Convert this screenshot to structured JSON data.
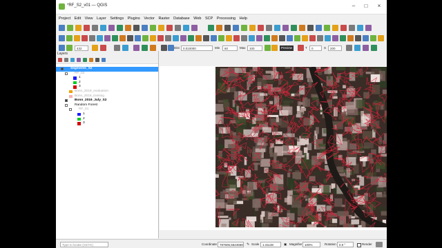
{
  "window": {
    "title": "*RF_S2_v01 — QGIS"
  },
  "menu": [
    "Project",
    "Edit",
    "View",
    "Layer",
    "Settings",
    "Plugins",
    "Vector",
    "Raster",
    "Database",
    "Web",
    "SCP",
    "Processing",
    "Help"
  ],
  "scp_toolbar": {
    "rgb_value": "432",
    "dist_label": "Dist",
    "dist_value": "0.010000",
    "min_label": "Min",
    "min_value": "60",
    "max_label": "Max",
    "max_value": "100",
    "preview_label": "Preview",
    "t_label": "T",
    "t_value": "0",
    "s_label": "S",
    "s_value": "200"
  },
  "layers_panel": {
    "title": "Layers",
    "layers": [
      {
        "label": "Segments_S2",
        "bold": true,
        "selected": true,
        "checked": true,
        "indent": 0
      },
      {
        "label": "RF_02",
        "muted": true,
        "checked": false,
        "indent": 1,
        "has_icon": true
      },
      {
        "label": "1",
        "swatch": "#1a1aff",
        "indent": 2
      },
      {
        "label": "2",
        "swatch": "#00cc22",
        "indent": 2
      },
      {
        "label": "3",
        "swatch": "#d40000",
        "indent": 2
      },
      {
        "label": "Bonn_2019_evaluation",
        "muted": true,
        "swatch": "#f0a000",
        "indent": 1
      },
      {
        "label": "Bonn_2019_training",
        "muted": true,
        "swatch": "#f8b0b0",
        "indent": 1
      },
      {
        "label": "Bonn_2019_July_S2",
        "bold": true,
        "checked": true,
        "indent": 1,
        "has_icon": true
      },
      {
        "label": "Random Forest",
        "checked": false,
        "indent": 1,
        "group": true
      },
      {
        "label": "RF_01",
        "muted": true,
        "checked": false,
        "indent": 2,
        "has_icon": true
      },
      {
        "label": "1",
        "swatch": "#1a1aff",
        "indent": 3
      },
      {
        "label": "2",
        "swatch": "#00cc22",
        "indent": 3
      },
      {
        "label": "3",
        "swatch": "#d40000",
        "indent": 3
      }
    ]
  },
  "statusbar": {
    "locate_placeholder": "Type to locate (Ctrl+K)",
    "coordinate_label": "Coordinate",
    "coordinate_value": "787605,5624668",
    "scale_label": "Scale",
    "scale_value": "1:41148",
    "magnifier_label": "Magnifier",
    "magnifier_value": "100%",
    "rotation_label": "Rotation",
    "rotation_value": "0.0 °",
    "render_label": "Render"
  },
  "colors": {
    "selection": "#3399ff",
    "segment_lines": "#d8243a",
    "map_background": "#3a2c26"
  }
}
